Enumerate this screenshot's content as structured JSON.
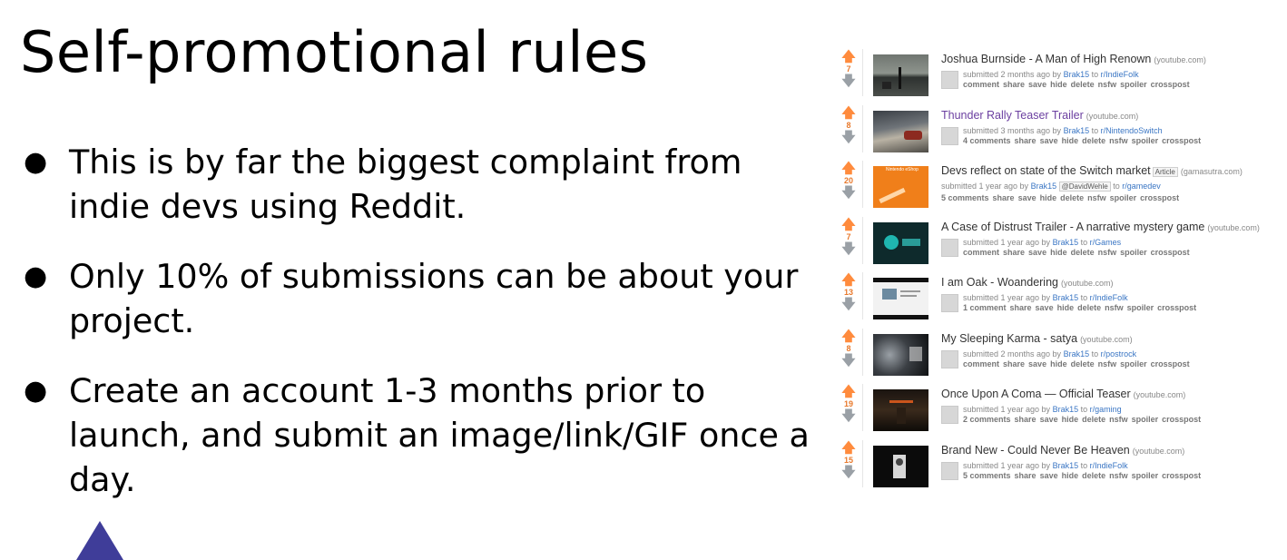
{
  "slide": {
    "title": "Self-promotional rules",
    "bullets": [
      "This is by far the biggest complaint from indie devs using Reddit.",
      "Only 10% of submissions can be about your project.",
      "Create an account 1-3 months prior to launch, and submit an image/link/GIF once a day."
    ],
    "accent_color": "#3f3d99"
  },
  "feed": {
    "posts": [
      {
        "score": "7",
        "title": "Joshua Burnside - A Man of High Renown",
        "domain": "(youtube.com)",
        "submitted": "submitted 2 months ago by",
        "user": "Brak15",
        "to": "to",
        "subreddit": "r/IndieFolk",
        "buttons": [
          "comment",
          "share",
          "save",
          "hide",
          "delete",
          "nsfw",
          "spoiler",
          "crosspost"
        ]
      },
      {
        "score": "8",
        "title": "Thunder Rally Teaser Trailer",
        "domain": "(youtube.com)",
        "submitted": "submitted 3 months ago by",
        "user": "Brak15",
        "to": "to",
        "subreddit": "r/NintendoSwitch",
        "buttons": [
          "4 comments",
          "share",
          "save",
          "hide",
          "delete",
          "nsfw",
          "spoiler",
          "crosspost"
        ]
      },
      {
        "score": "20",
        "title": "Devs reflect on state of the Switch market",
        "tag": "Article",
        "domain": "(gamasutra.com)",
        "submitted": "submitted 1 year ago by",
        "user": "Brak15",
        "mention": "@DavidWehle",
        "to": "to",
        "subreddit": "r/gamedev",
        "buttons": [
          "5 comments",
          "share",
          "save",
          "hide",
          "delete",
          "nsfw",
          "spoiler",
          "crosspost"
        ],
        "thumb_text": "Nintendo eShop"
      },
      {
        "score": "7",
        "title": "A Case of Distrust Trailer - A narrative mystery game",
        "domain": "(youtube.com)",
        "submitted": "submitted 1 year ago by",
        "user": "Brak15",
        "to": "to",
        "subreddit": "r/Games",
        "buttons": [
          "comment",
          "share",
          "save",
          "hide",
          "delete",
          "nsfw",
          "spoiler",
          "crosspost"
        ]
      },
      {
        "score": "13",
        "title": "I am Oak - Woandering",
        "domain": "(youtube.com)",
        "submitted": "submitted 1 year ago by",
        "user": "Brak15",
        "to": "to",
        "subreddit": "r/IndieFolk",
        "buttons": [
          "1 comment",
          "share",
          "save",
          "hide",
          "delete",
          "nsfw",
          "spoiler",
          "crosspost"
        ]
      },
      {
        "score": "8",
        "title": "My Sleeping Karma - satya",
        "domain": "(youtube.com)",
        "submitted": "submitted 2 months ago by",
        "user": "Brak15",
        "to": "to",
        "subreddit": "r/postrock",
        "buttons": [
          "comment",
          "share",
          "save",
          "hide",
          "delete",
          "nsfw",
          "spoiler",
          "crosspost"
        ]
      },
      {
        "score": "19",
        "title": "Once Upon A Coma — Official Teaser",
        "domain": "(youtube.com)",
        "submitted": "submitted 1 year ago by",
        "user": "Brak15",
        "to": "to",
        "subreddit": "r/gaming",
        "buttons": [
          "2 comments",
          "share",
          "save",
          "hide",
          "delete",
          "nsfw",
          "spoiler",
          "crosspost"
        ]
      },
      {
        "score": "15",
        "title": "Brand New - Could Never Be Heaven",
        "domain": "(youtube.com)",
        "submitted": "submitted 1 year ago by",
        "user": "Brak15",
        "to": "to",
        "subreddit": "r/IndieFolk",
        "buttons": [
          "5 comments",
          "share",
          "save",
          "hide",
          "delete",
          "nsfw",
          "spoiler",
          "crosspost"
        ]
      }
    ]
  }
}
